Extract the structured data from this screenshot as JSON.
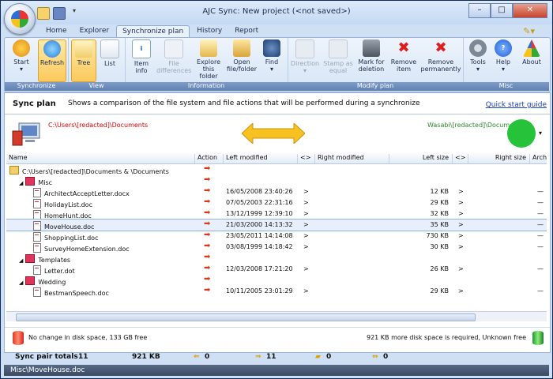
{
  "window": {
    "title": "AJC Sync:  New project  (<not saved>)"
  },
  "tabs": [
    "Home",
    "Explorer",
    "Synchronize plan",
    "History",
    "Report"
  ],
  "ribbon": {
    "groups": [
      "Synchronize",
      "View",
      "Information",
      "Modify plan",
      "Misc"
    ],
    "start": "Start",
    "refresh": "Refresh",
    "tree": "Tree",
    "list": "List",
    "item_info": "Item info",
    "file_differences": "File differences",
    "explore": "Explore this folder",
    "open": "Open file/folder",
    "find": "Find",
    "direction": "Direction",
    "stamp": "Stamp as equal",
    "mark": "Mark for deletion",
    "remove_item": "Remove item",
    "remove_perm": "Remove permanently",
    "tools": "Tools",
    "help": "Help",
    "about": "About"
  },
  "plan": {
    "title": "Sync plan",
    "desc": "Shows a comparison of the file system and file actions that will be performed during a synchronize",
    "quick_start": "Quick start guide",
    "left_path": "C:\\Users\\[redacted]\\Documents",
    "right_path": "Wasabi\\[redacted]\\Documents"
  },
  "columns": [
    "Name",
    "Action",
    "Left modified",
    "<>",
    "Right modified",
    "Left size",
    "<>",
    "Right size",
    "Arch"
  ],
  "rows": [
    {
      "name": "C:\\Users\\[redacted]\\Documents & \\Documents",
      "type": "root",
      "lm": "",
      "cmp": "",
      "ls": "",
      "arch": ""
    },
    {
      "name": "Misc",
      "type": "folder",
      "lm": "",
      "cmp": "",
      "ls": "",
      "arch": ""
    },
    {
      "name": "ArchitectAcceptLetter.docx",
      "type": "file",
      "lm": "16/05/2008 23:40:26",
      "cmp": ">",
      "ls": "12 KB",
      "arch": "—"
    },
    {
      "name": "HolidayList.doc",
      "type": "file",
      "lm": "07/05/2003 22:31:16",
      "cmp": ">",
      "ls": "29 KB",
      "arch": "—"
    },
    {
      "name": "HomeHunt.doc",
      "type": "file",
      "lm": "13/12/1999 12:39:10",
      "cmp": ">",
      "ls": "32 KB",
      "arch": "—"
    },
    {
      "name": "MoveHouse.doc",
      "type": "file",
      "lm": "21/03/2000 14:13:32",
      "cmp": ">",
      "ls": "35 KB",
      "arch": "—",
      "selected": true
    },
    {
      "name": "ShoppingList.doc",
      "type": "file",
      "lm": "23/05/2011 14:14:08",
      "cmp": ">",
      "ls": "730 KB",
      "arch": "—"
    },
    {
      "name": "SurveyHomeExtension.doc",
      "type": "file",
      "lm": "03/08/1999 14:18:42",
      "cmp": ">",
      "ls": "30 KB",
      "arch": "—"
    },
    {
      "name": "Templates",
      "type": "folder",
      "lm": "",
      "cmp": "",
      "ls": "",
      "arch": ""
    },
    {
      "name": "Letter.dot",
      "type": "file",
      "lm": "12/03/2008 17:21:20",
      "cmp": ">",
      "ls": "26 KB",
      "arch": "—"
    },
    {
      "name": "Wedding",
      "type": "folder",
      "lm": "",
      "cmp": "",
      "ls": "",
      "arch": ""
    },
    {
      "name": "BestmanSpeech.doc",
      "type": "file",
      "lm": "10/11/2005 23:01:29",
      "cmp": ">",
      "ls": "29 KB",
      "arch": "—"
    }
  ],
  "disk": {
    "left": "No change in disk space, 133 GB free",
    "right": "921 KB more disk space is required, Unknown free"
  },
  "totals": {
    "label": "Sync pair totals",
    "count": "11",
    "size": "921 KB",
    "left_arrow": "0",
    "right_arrow": "11",
    "folder": "0",
    "conflict": "0"
  },
  "status": "Misc\\MoveHouse.doc",
  "colors": {
    "accent": "#fbc95c",
    "left_path": "#dd0000",
    "right_path": "#2a8a2a",
    "action_arrow": "#d63a1e"
  }
}
